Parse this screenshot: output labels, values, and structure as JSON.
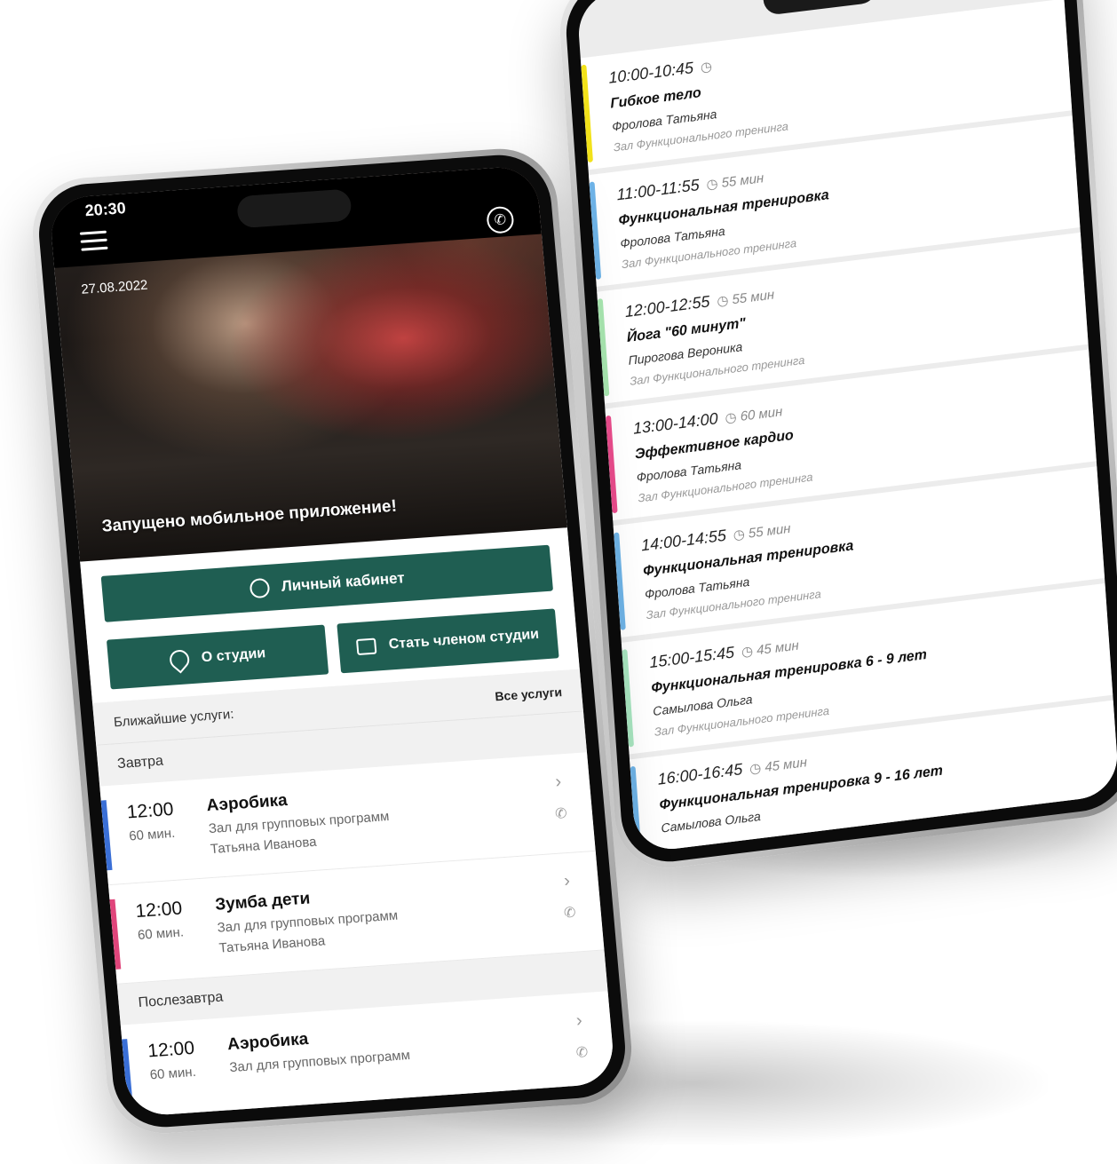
{
  "front": {
    "status_time": "20:30",
    "date": "27.08.2022",
    "banner": "Запущено мобильное приложение!",
    "buttons": {
      "cabinet": "Личный кабинет",
      "about": "О студии",
      "member": "Стать членом студии"
    },
    "section_title": "Ближайшие услуги:",
    "all_services": "Все услуги",
    "days": [
      {
        "label": "Завтра",
        "items": [
          {
            "time": "12:00",
            "duration": "60 мин.",
            "title": "Аэробика",
            "hall": "Зал для групповых программ",
            "trainer": "Татьяна Иванова",
            "color": "#3a6fd6"
          },
          {
            "time": "12:00",
            "duration": "60 мин.",
            "title": "Зумба дети",
            "hall": "Зал для групповых программ",
            "trainer": "Татьяна Иванова",
            "color": "#e0457b"
          }
        ]
      },
      {
        "label": "Послезавтра",
        "items": [
          {
            "time": "12:00",
            "duration": "60 мин.",
            "title": "Аэробика",
            "hall": "Зал для групповых программ",
            "trainer": "",
            "color": "#3a6fd6"
          }
        ]
      }
    ]
  },
  "back": {
    "schedule": [
      {
        "time": "10:00-10:45",
        "duration": "",
        "title": "Гибкое тело",
        "trainer": "Фролова Татьяна",
        "hall": "Зал Функционального тренинга",
        "color": "#f2e21a"
      },
      {
        "time": "11:00-11:55",
        "duration": "55 мин",
        "title": "Функциональная тренировка",
        "trainer": "Фролова Татьяна",
        "hall": "Зал Функционального тренинга",
        "color": "#6fb4e8"
      },
      {
        "time": "12:00-12:55",
        "duration": "55 мин",
        "title": "Йога \"60 минут\"",
        "trainer": "Пирогова Вероника",
        "hall": "Зал Функционального тренинга",
        "color": "#a8e6b0"
      },
      {
        "time": "13:00-14:00",
        "duration": "60 мин",
        "title": "Эффективное кардио",
        "trainer": "Фролова Татьяна",
        "hall": "Зал Функционального тренинга",
        "color": "#ea4c8c"
      },
      {
        "time": "14:00-14:55",
        "duration": "55 мин",
        "title": "Функциональная тренировка",
        "trainer": "Фролова Татьяна",
        "hall": "Зал Функционального тренинга",
        "color": "#6fb4e8"
      },
      {
        "time": "15:00-15:45",
        "duration": "45 мин",
        "title": "Функциональная тренировка 6 - 9 лет",
        "trainer": "Самылова Ольга",
        "hall": "Зал Функционального тренинга",
        "color": "#a8e6c0"
      },
      {
        "time": "16:00-16:45",
        "duration": "45 мин",
        "title": "Функциональная тренировка 9 - 16 лет",
        "trainer": "Самылова Ольга",
        "hall": "",
        "color": "#6fb4e8"
      }
    ]
  }
}
